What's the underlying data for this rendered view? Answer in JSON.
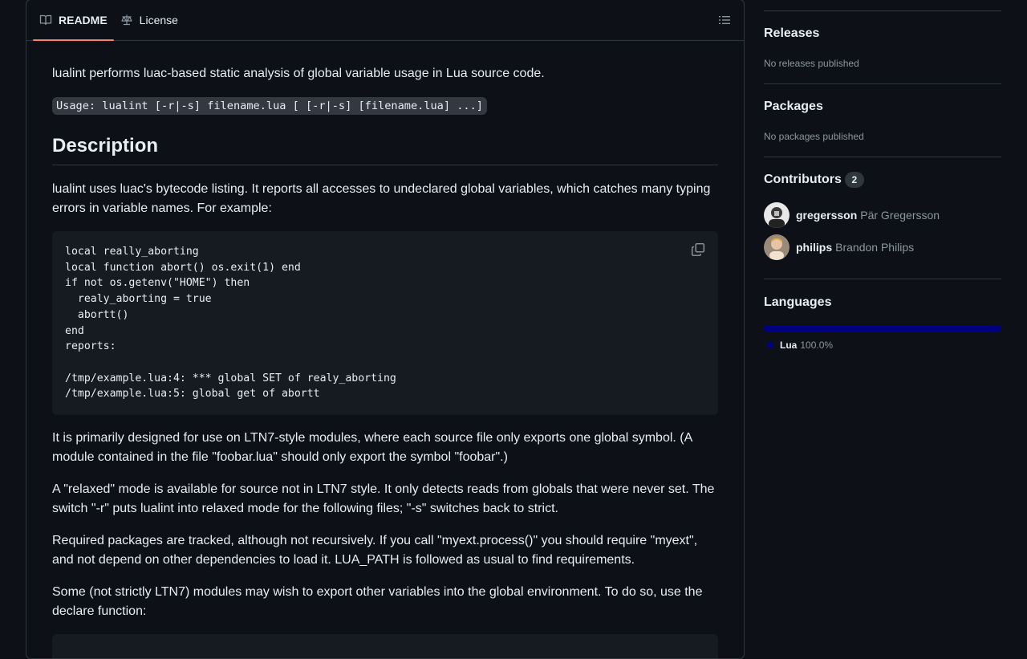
{
  "readme": {
    "tabs": [
      {
        "label": "README",
        "icon": "book-icon",
        "active": true
      },
      {
        "label": "License",
        "icon": "scale-icon",
        "active": false
      }
    ],
    "toc_icon": "list-unordered-icon",
    "intro": "lualint performs luac-based static analysis of global variable usage in Lua source code.",
    "usage": "Usage: lualint [-r|-s] filename.lua [ [-r|-s] [filename.lua] ...]",
    "heading_description": "Description",
    "para1": "lualint uses luac's bytecode listing. It reports all accesses to undeclared global variables, which catches many typing errors in variable names. For example:",
    "code_block": "local really_aborting\nlocal function abort() os.exit(1) end\nif not os.getenv(\"HOME\") then\n  realy_aborting = true\n  abortt()\nend\nreports:\n\n/tmp/example.lua:4: *** global SET of realy_aborting\n/tmp/example.lua:5: global get of abortt",
    "para2": "It is primarily designed for use on LTN7-style modules, where each source file only exports one global symbol. (A module contained in the file \"foobar.lua\" should only export the symbol \"foobar\".)",
    "para3": "A \"relaxed\" mode is available for source not in LTN7 style. It only detects reads from globals that were never set. The switch \"-r\" puts lualint into relaxed mode for the following files; \"-s\" switches back to strict.",
    "para4": "Required packages are tracked, although not recursively. If you call \"myext.process()\" you should require \"myext\", and not depend on other dependencies to load it. LUA_PATH is followed as usual to find requirements.",
    "para5": "Some (not strictly LTN7) modules may wish to export other variables into the global environment. To do so, use the declare function:"
  },
  "sidebar": {
    "releases": {
      "title": "Releases",
      "empty": "No releases published"
    },
    "packages": {
      "title": "Packages",
      "empty": "No packages published"
    },
    "contributors": {
      "title": "Contributors",
      "count": "2",
      "people": [
        {
          "login": "gregersson",
          "name": "Pär Gregersson"
        },
        {
          "login": "philips",
          "name": "Brandon Philips"
        }
      ]
    },
    "languages": {
      "title": "Languages",
      "items": [
        {
          "name": "Lua",
          "percent": "100.0%",
          "color": "#000080"
        }
      ]
    }
  },
  "colors": {
    "background": "#0d1117",
    "border": "#30363d",
    "accent": "#f78166",
    "muted": "#8d96a0"
  }
}
